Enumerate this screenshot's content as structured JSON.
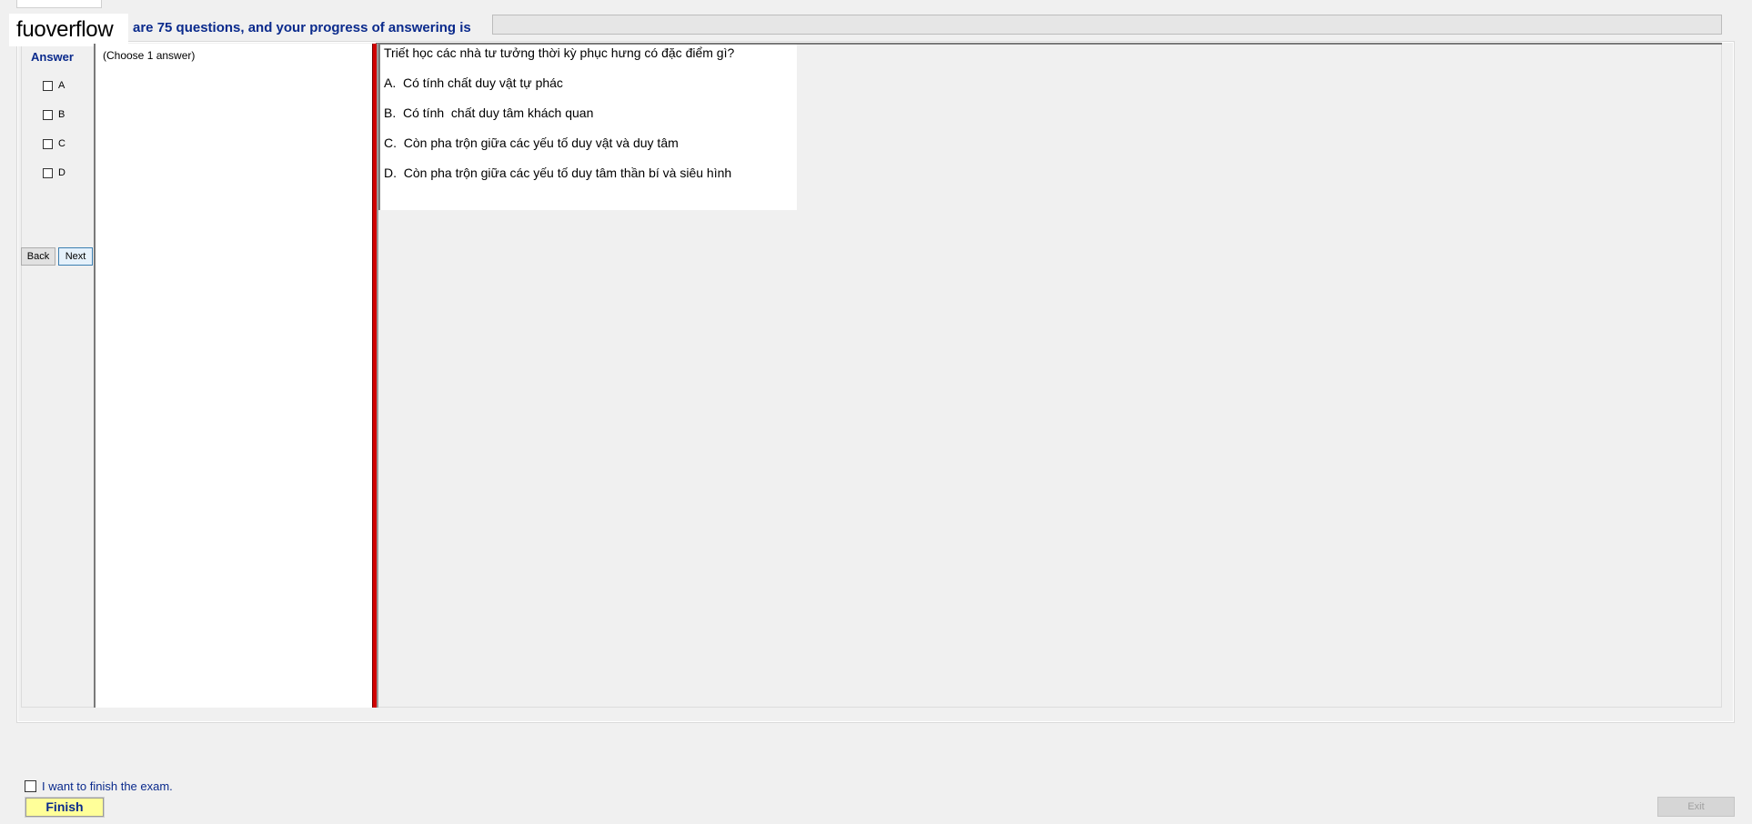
{
  "watermark": "fuoverflow",
  "header": {
    "text": "are 75 questions, and your progress of answering is",
    "progress_percent": 0
  },
  "answer_panel": {
    "title": "Answer",
    "options": [
      "A",
      "B",
      "C",
      "D"
    ],
    "back_label": "Back",
    "next_label": "Next"
  },
  "choose_panel": {
    "instruction": "(Choose 1 answer)"
  },
  "question": {
    "text": "Triết học các nhà tư tưởng thời kỳ phục hưng có đặc điểm gì?",
    "choices": [
      "A.  Có tính chất duy vật tự phác",
      "B.  Có tính  chất duy tâm khách quan",
      "C.  Còn pha trộn giữa các yếu tố duy vật và duy tâm",
      "D.  Còn pha trộn giữa các yếu tố duy tâm thần bí và siêu hình"
    ]
  },
  "footer": {
    "finish_check_label": "I want to finish the exam.",
    "finish_label": "Finish",
    "exit_label": "Exit"
  },
  "colors": {
    "accent_blue": "#0a2a8c",
    "splitter_red": "#d00000",
    "finish_yellow": "#ffff99"
  }
}
